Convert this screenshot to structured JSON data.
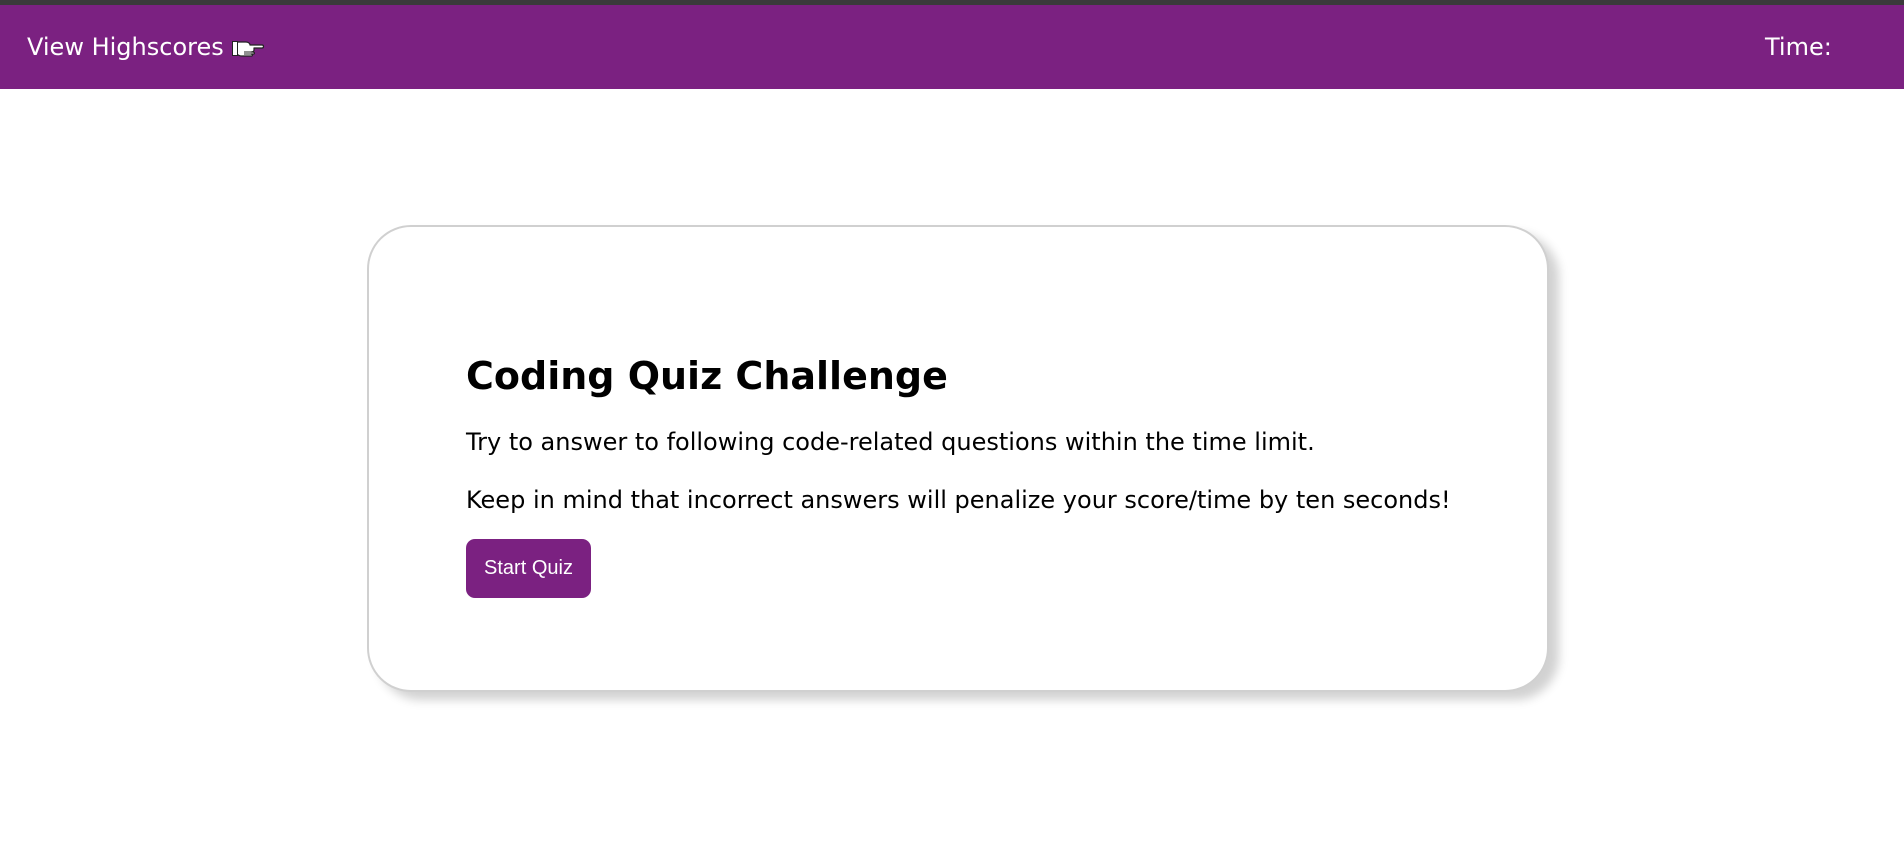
{
  "header": {
    "highscores_label": "View Highscores",
    "highscores_icon": "pointing-hand-icon",
    "timer_label": "Time:",
    "timer_value": ""
  },
  "quiz": {
    "title": "Coding Quiz Challenge",
    "intro_lines": [
      "Try to answer to following code-related questions within the time limit.",
      "Keep in mind that incorrect answers will penalize your score/time by ten seconds!"
    ],
    "start_label": "Start Quiz"
  },
  "colors": {
    "brand_purple": "#7b2181",
    "background": "#ffffff",
    "card_border": "#d0d0d0",
    "top_strip": "#3a3a3a"
  }
}
